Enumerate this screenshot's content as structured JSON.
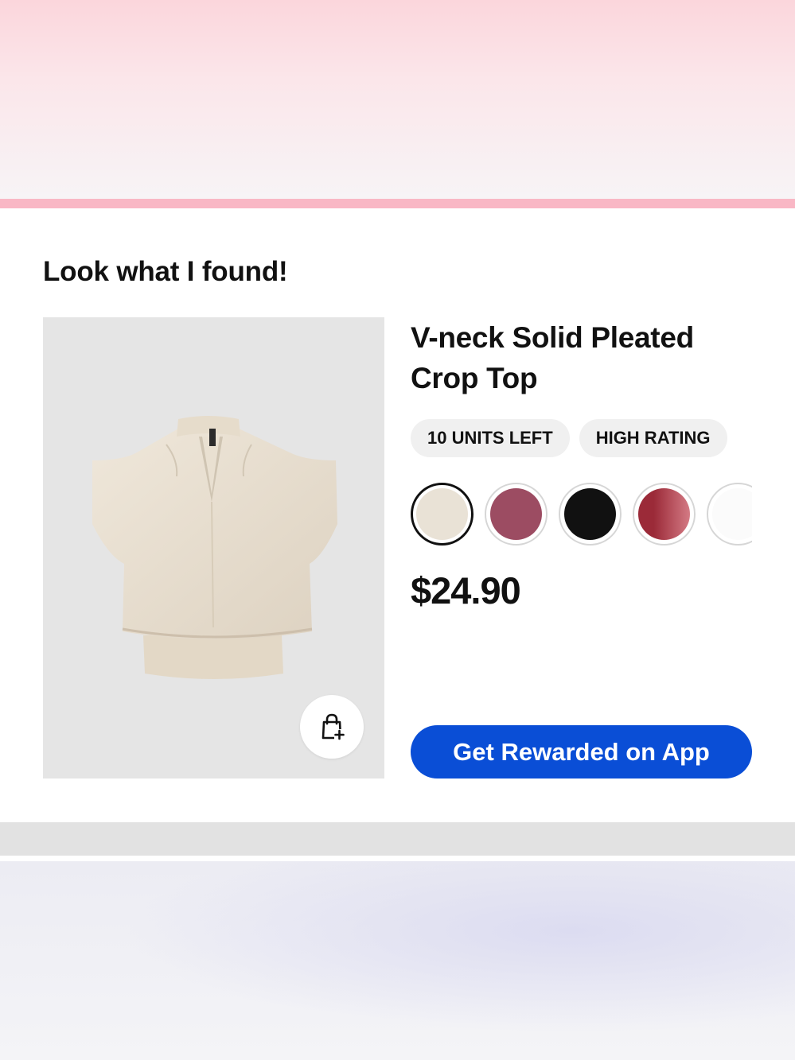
{
  "card": {
    "headline": "Look what I found!",
    "product": {
      "title": "V-neck Solid Pleated Crop Top",
      "badges": [
        "10 UNITS LEFT",
        "HIGH RATING"
      ],
      "price": "$24.90",
      "swatches": [
        {
          "color": "#e9e2d6",
          "selected": true
        },
        {
          "color": "#9c4c62",
          "selected": false
        },
        {
          "color": "#111111",
          "selected": false
        },
        {
          "color": "#9b2a38",
          "selected": false
        },
        {
          "color": "#fbfbfb",
          "selected": false
        }
      ],
      "image_background": "#e5e5e5",
      "cart_icon": "shopping-bag-plus-icon"
    },
    "cta_label": "Get Rewarded on App",
    "cta_color": "#0a4ed6"
  }
}
